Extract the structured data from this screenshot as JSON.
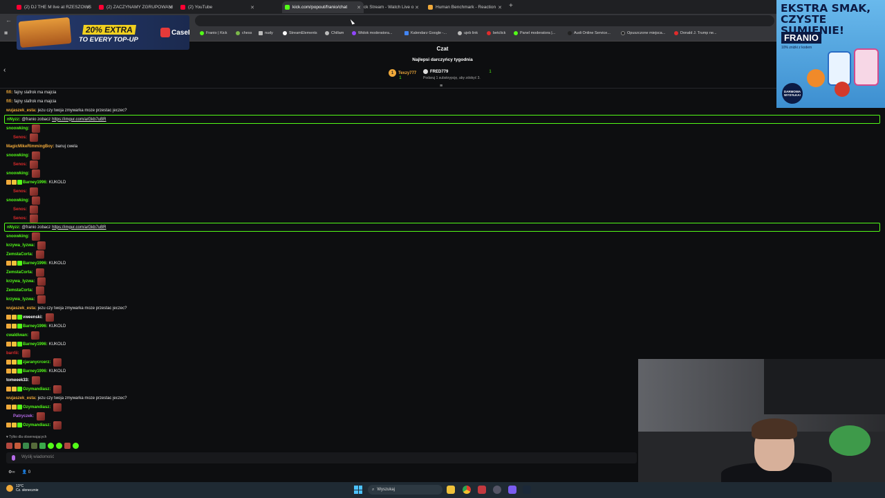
{
  "browser": {
    "tabs": [
      {
        "label": "(2) DJ THE M live at RZESZOWS",
        "color": "#ff0033"
      },
      {
        "label": "(2) ZACZYNAMY ZGRUPOWANI",
        "color": "#ff0033"
      },
      {
        "label": "(2) YouTube",
        "color": "#ff0033"
      },
      {
        "label": "kick.com/popout/franio/chat",
        "color": "#53fc18"
      },
      {
        "label": "ck Stream - Watch Live o",
        "color": "#ffffff"
      },
      {
        "label": "Human Benchmark - Reaction",
        "color": "#f0a93a"
      }
    ],
    "new_tab": "+",
    "bookmarks": [
      {
        "label": "Franio | Kick",
        "color": "#53fc18"
      },
      {
        "label": "chess",
        "color": "#7bb84a"
      },
      {
        "label": "nudy",
        "color": "#bbbbbb"
      },
      {
        "label": "StreamElements",
        "color": "#ffffff"
      },
      {
        "label": "Chillam",
        "color": "#bbbbbb"
      },
      {
        "label": "Widok moderatora...",
        "color": "#9146ff"
      },
      {
        "label": "Kalendarz Google -...",
        "color": "#4285f4"
      },
      {
        "label": "ujeb link",
        "color": "#bbbbbb"
      },
      {
        "label": "betclick",
        "color": "#e02b2b"
      },
      {
        "label": "Panel moderatora |...",
        "color": "#53fc18"
      },
      {
        "label": "Audi Online Service...",
        "color": "#222222"
      },
      {
        "label": "Opuszczone miejsca...",
        "color": "#222222"
      },
      {
        "label": "Donald J. Trump ne...",
        "color": "#e02b2b"
      }
    ]
  },
  "ad_left": {
    "percent": "20% EXTRA",
    "tagline": "TO EVERY TOP-UP",
    "brand": "CaseHug"
  },
  "ad_right": {
    "headline": "EKSTRA SMAK, CZYSTE SUMIENIE!",
    "brand": "FRANIO",
    "sub": "10% zniżki z kodem",
    "badge": "DARMOWA WYSYŁKA!"
  },
  "chat": {
    "title": "Czat",
    "donors_title": "Najlepsi darczyńcy tygodnia",
    "donors": [
      {
        "rank": "1",
        "name": "Texzy777",
        "count": "1"
      },
      {
        "rank": "",
        "name": "FRED779",
        "count": "1"
      }
    ],
    "donor_hint": "Podaruj 1 subskrypcję, aby zdobyć 3.",
    "messages": [
      {
        "user": "fifi:",
        "ucolor": "#f0a93a",
        "text": "fajny slafrok ma majcia"
      },
      {
        "user": "fifi:",
        "ucolor": "#f0a93a",
        "text": "fajny slafrok ma majcia"
      },
      {
        "user": "wujaszek_esta:",
        "ucolor": "#f0a93a",
        "text": "jezu czy twoja zmywarka moze przestac jeczec?"
      },
      {
        "user": "nNyzz:",
        "ucolor": "#53fc18",
        "text": "@franio zobacz",
        "link": "https://imgur.com/a/Gkb7uBR",
        "hl": true
      },
      {
        "user": "snoowking:",
        "ucolor": "#53fc18",
        "emote": true
      },
      {
        "user": "Senos:",
        "ucolor": "#e02b2b",
        "emote": true,
        "indent": true
      },
      {
        "user": "MagicMikeRimmingBoy:",
        "ucolor": "#f0a93a",
        "text": "banuj cwela"
      },
      {
        "user": "snoowking:",
        "ucolor": "#53fc18",
        "emote": true
      },
      {
        "user": "Senos:",
        "ucolor": "#e02b2b",
        "emote": true,
        "indent": true
      },
      {
        "user": "snoowking:",
        "ucolor": "#53fc18",
        "emote": true
      },
      {
        "user": "Barney1996:",
        "ucolor": "#53fc18",
        "text": "KUKOLD",
        "badges": true
      },
      {
        "user": "Senos:",
        "ucolor": "#e02b2b",
        "emote": true,
        "indent": true
      },
      {
        "user": "snoowking:",
        "ucolor": "#53fc18",
        "emote": true
      },
      {
        "user": "Senos:",
        "ucolor": "#e02b2b",
        "emote": true,
        "indent": true
      },
      {
        "user": "Senos:",
        "ucolor": "#e02b2b",
        "emote": true,
        "indent": true
      },
      {
        "user": "nNyzz:",
        "ucolor": "#53fc18",
        "text": "@franio zobacz",
        "link": "https://imgur.com/a/Gkb7uBR",
        "hl": true
      },
      {
        "user": "snoowking:",
        "ucolor": "#53fc18",
        "emote": true
      },
      {
        "user": "krzywa_lyzwa:",
        "ucolor": "#53fc18",
        "emote": true
      },
      {
        "user": "ZemstaCorta:",
        "ucolor": "#53fc18",
        "emote": true
      },
      {
        "user": "Barney1996:",
        "ucolor": "#53fc18",
        "text": "KUKOLD",
        "badges": true
      },
      {
        "user": "ZemstaCorta:",
        "ucolor": "#53fc18",
        "emote": true
      },
      {
        "user": "krzywa_lyzwa:",
        "ucolor": "#53fc18",
        "emote": true
      },
      {
        "user": "ZemstaCorta:",
        "ucolor": "#53fc18",
        "emote": true
      },
      {
        "user": "krzywa_lyzwa:",
        "ucolor": "#53fc18",
        "emote": true
      },
      {
        "user": "wujaszek_esta:",
        "ucolor": "#f0a93a",
        "text": "jezu czy twoja zmywarka moze przestac jeczec?"
      },
      {
        "user": "vweenski:",
        "ucolor": "#ffffff",
        "emote": true,
        "badges": true
      },
      {
        "user": "Barney1996:",
        "ucolor": "#53fc18",
        "text": "KUKOLD",
        "badges": true
      },
      {
        "user": "cwaldiwan:",
        "ucolor": "#53fc18",
        "emote": true
      },
      {
        "user": "Barney1996:",
        "ucolor": "#53fc18",
        "text": "KUKOLD",
        "badges": true
      },
      {
        "user": "barrlii:",
        "ucolor": "#e02b2b",
        "emote": true
      },
      {
        "user": "zjaranycrcerz:",
        "ucolor": "#53fc18",
        "emote": true,
        "badges": true
      },
      {
        "user": "Barney1996:",
        "ucolor": "#53fc18",
        "text": "KUKOLD",
        "badges": true
      },
      {
        "user": "tomeeek33:",
        "ucolor": "#ffffff",
        "emote": true
      },
      {
        "user": "Ozymandiasz:",
        "ucolor": "#53fc18",
        "emote": true,
        "badges": true
      },
      {
        "user": "wujaszek_esta:",
        "ucolor": "#f0a93a",
        "text": "jezu czy twoja zmywarka moze przestac jeczec?"
      },
      {
        "user": "Ozymandiasz:",
        "ucolor": "#53fc18",
        "emote": true,
        "badges": true
      },
      {
        "user": "Patryczek:",
        "ucolor": "#b56be8",
        "emote": true,
        "indent": true
      },
      {
        "user": "Ozymandiasz:",
        "ucolor": "#53fc18",
        "emote": true,
        "badges": true
      }
    ],
    "followers_only": "♥ Tylko dla obserwujących",
    "input_placeholder": "Wyślij wiadomość",
    "viewer_count": "0"
  },
  "taskbar": {
    "temp": "13°C",
    "weather": "Cz. słonecznie",
    "search": "Wyszukaj"
  }
}
